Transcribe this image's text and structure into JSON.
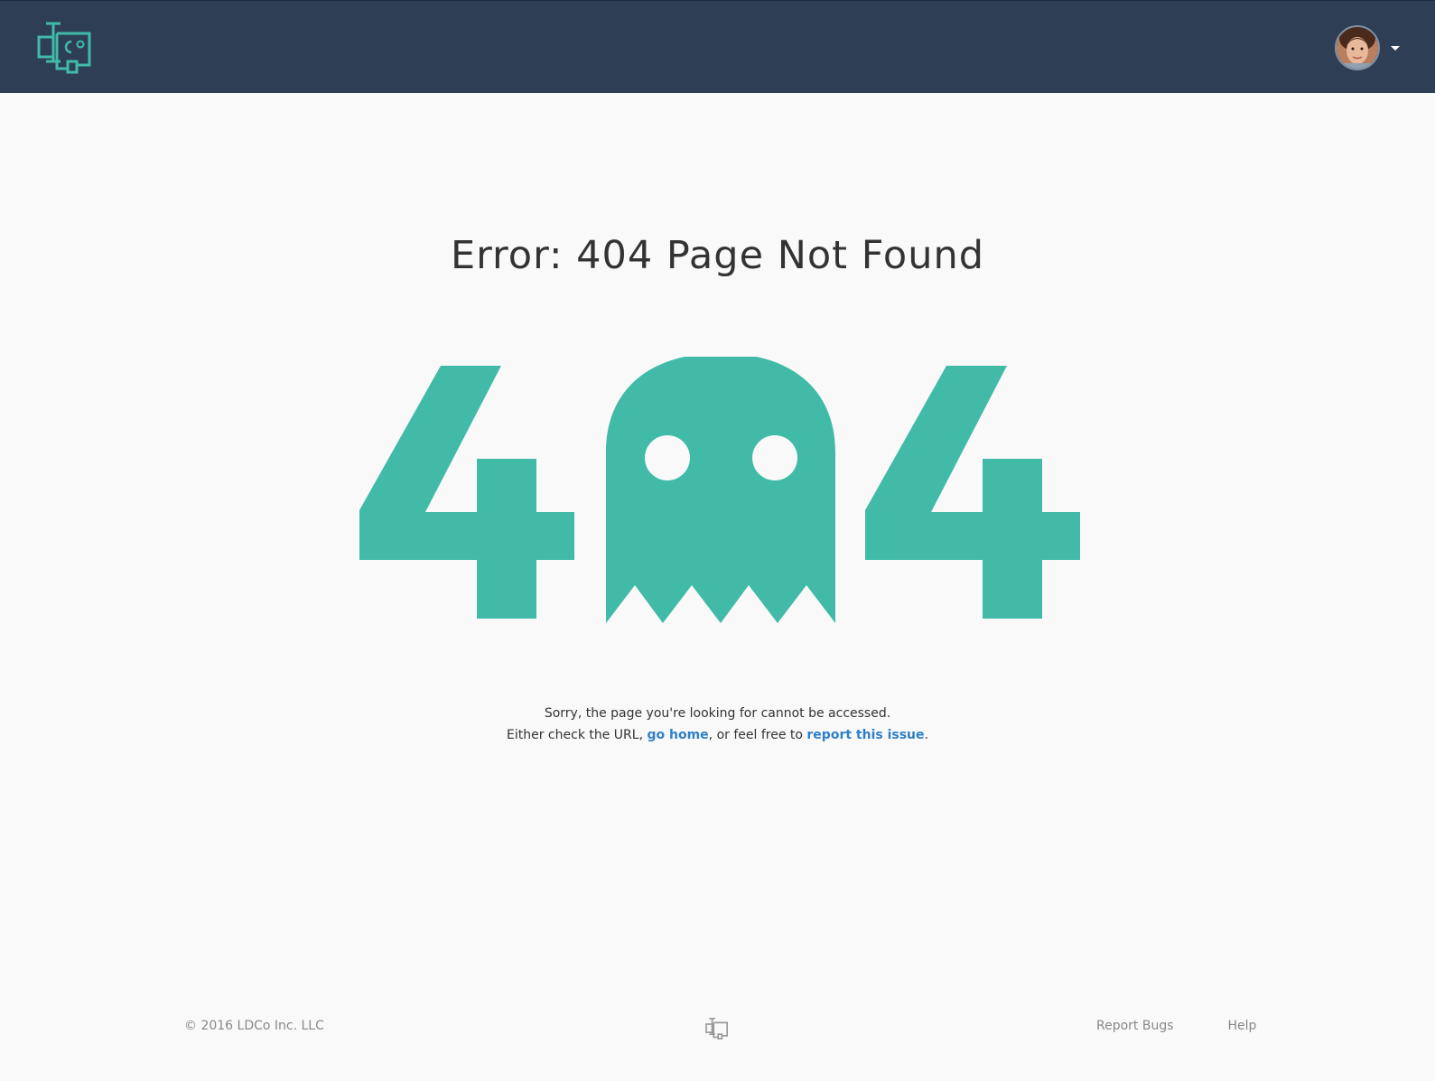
{
  "header": {
    "logo_icon": "ldco-logo-icon",
    "user_avatar": "user-avatar",
    "dropdown_icon": "caret-down-icon"
  },
  "error": {
    "title": "Error: 404 Page Not Found",
    "graphic_left_digit": "4",
    "graphic_right_digit": "4",
    "graphic_middle_icon": "ghost-icon",
    "line1": "Sorry, the page you're looking for cannot be accessed.",
    "line2_prefix": "Either check the URL, ",
    "go_home_link": "go home",
    "line2_middle": ", or feel free to ",
    "report_link": "report this issue",
    "line2_suffix": "."
  },
  "footer": {
    "copyright": "© 2016 LDCo Inc. LLC",
    "logo_icon": "ldco-logo-small-icon",
    "links": [
      "Report Bugs",
      "Help"
    ]
  },
  "colors": {
    "header_bg": "#2d3e55",
    "accent": "#41bba8",
    "link": "#2f7fc8",
    "page_bg": "#f9f9f9",
    "footer_text": "#888888"
  }
}
